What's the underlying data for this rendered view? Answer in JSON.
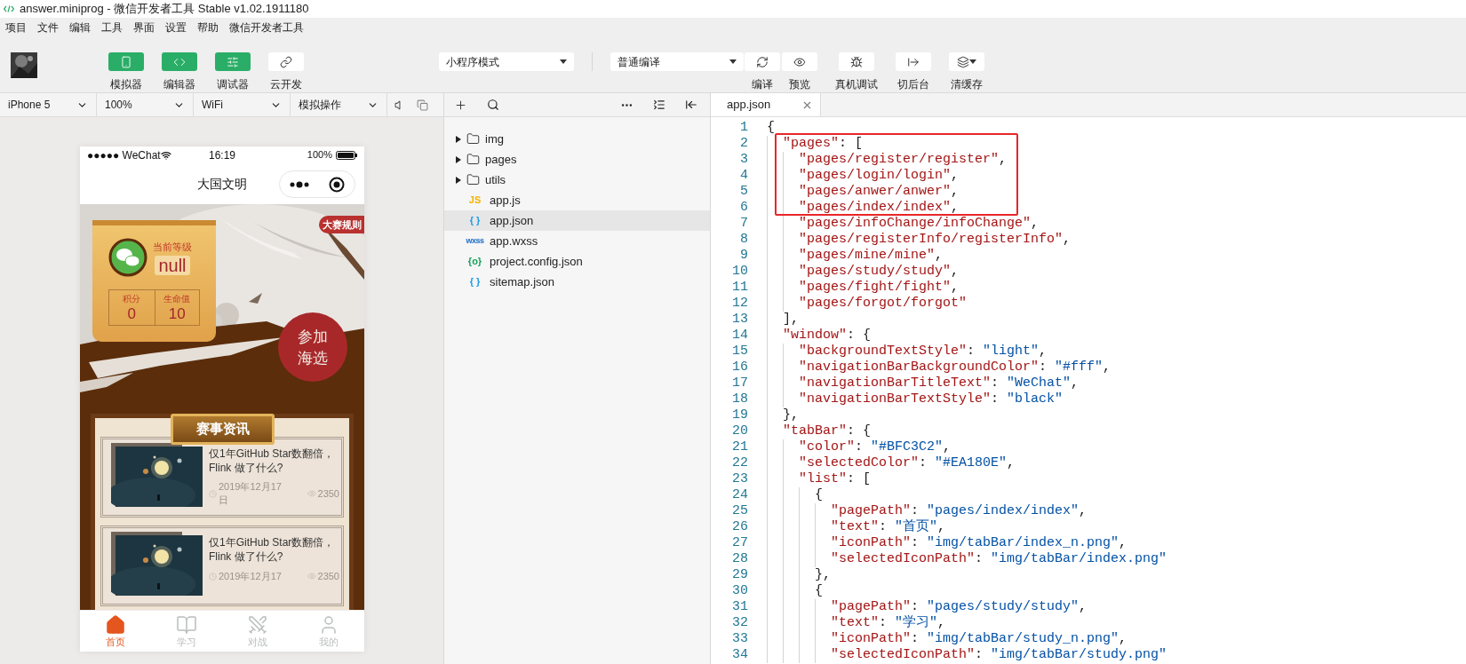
{
  "window": {
    "title": "answer.miniprog - 微信开发者工具 Stable v1.02.1911180"
  },
  "menu": [
    "项目",
    "文件",
    "编辑",
    "工具",
    "界面",
    "设置",
    "帮助",
    "微信开发者工具"
  ],
  "toolbar": {
    "left": [
      {
        "label": "模拟器",
        "kind": "phone",
        "on": true
      },
      {
        "label": "编辑器",
        "kind": "code",
        "on": true
      },
      {
        "label": "调试器",
        "kind": "debug",
        "on": true
      },
      {
        "label": "云开发",
        "kind": "cloud",
        "on": false
      }
    ],
    "mode": "小程序模式",
    "compile": "普通编译",
    "right": [
      {
        "label": "编译",
        "kind": "refresh"
      },
      {
        "label": "预览",
        "kind": "eye"
      },
      {
        "label": "真机调试",
        "kind": "bug"
      },
      {
        "label": "切后台",
        "kind": "switch"
      },
      {
        "label": "清缓存",
        "kind": "layers"
      }
    ]
  },
  "simulator_bar": [
    "iPhone 5",
    "100%",
    "WiFi",
    "模拟操作"
  ],
  "phone": {
    "status": {
      "carrier": "●●●●● WeChat",
      "time": "16:19",
      "battery": "100%"
    },
    "title": "大国文明",
    "profile": {
      "rank_label": "当前等级",
      "rank": "null",
      "stats": [
        {
          "label": "积分",
          "value": "0"
        },
        {
          "label": "生命值",
          "value": "10"
        }
      ]
    },
    "rules_badge": "大赛规则",
    "join_button": "参加海选",
    "section_title": "赛事资讯",
    "news": [
      {
        "title": "仅1年GitHub Star数翻倍，Flink 做了什么?",
        "date": "2019年12月17日",
        "views": "2350"
      },
      {
        "title": "仅1年GitHub Star数翻倍，Flink 做了什么?",
        "date": "2019年12月17",
        "views": "2350"
      }
    ],
    "tabbar": [
      {
        "label": "首页",
        "kind": "home",
        "selected": true
      },
      {
        "label": "学习",
        "kind": "book",
        "selected": false
      },
      {
        "label": "对战",
        "kind": "fight",
        "selected": false
      },
      {
        "label": "我的",
        "kind": "user",
        "selected": false
      }
    ]
  },
  "files": [
    {
      "name": "img",
      "kind": "folder",
      "expanded": false,
      "selected": false
    },
    {
      "name": "pages",
      "kind": "folder",
      "expanded": false,
      "selected": false
    },
    {
      "name": "utils",
      "kind": "folder",
      "expanded": false,
      "selected": false
    },
    {
      "name": "app.js",
      "kind": "file",
      "icon": "JS",
      "color": "#f5b400",
      "selected": false
    },
    {
      "name": "app.json",
      "kind": "file",
      "icon": "{ }",
      "color": "#1e9be6",
      "selected": true
    },
    {
      "name": "app.wxss",
      "kind": "file",
      "icon": "wxss",
      "color": "#1a6cc9",
      "selected": false
    },
    {
      "name": "project.config.json",
      "kind": "file",
      "icon": "{o}",
      "color": "#17a05a",
      "selected": false
    },
    {
      "name": "sitemap.json",
      "kind": "file",
      "icon": "{ }",
      "color": "#1e9be6",
      "selected": false
    }
  ],
  "editor": {
    "tabs": [
      {
        "label": "app.json",
        "selected": true
      }
    ],
    "lines": [
      {
        "no": "1",
        "text": "{",
        "marked": false
      },
      {
        "no": "2",
        "text": "  \"pages\": [",
        "marked": true
      },
      {
        "no": "3",
        "text": "    \"pages/register/register\",",
        "marked": true
      },
      {
        "no": "4",
        "text": "    \"pages/login/login\",",
        "marked": true
      },
      {
        "no": "5",
        "text": "    \"pages/anwer/anwer\",",
        "marked": true
      },
      {
        "no": "6",
        "text": "    \"pages/index/index\",",
        "marked": true
      },
      {
        "no": "7",
        "text": "    \"pages/infoChange/infoChange\",",
        "marked": false
      },
      {
        "no": "8",
        "text": "    \"pages/registerInfo/registerInfo\",",
        "marked": false
      },
      {
        "no": "9",
        "text": "    \"pages/mine/mine\",",
        "marked": false
      },
      {
        "no": "10",
        "text": "    \"pages/study/study\",",
        "marked": false
      },
      {
        "no": "11",
        "text": "    \"pages/fight/fight\",",
        "marked": false
      },
      {
        "no": "12",
        "text": "    \"pages/forgot/forgot\"",
        "marked": false
      },
      {
        "no": "13",
        "text": "  ],",
        "marked": false
      },
      {
        "no": "14",
        "text": "  \"window\": {",
        "marked": false
      },
      {
        "no": "15",
        "text": "    \"backgroundTextStyle\": \"light\",",
        "marked": false
      },
      {
        "no": "16",
        "text": "    \"navigationBarBackgroundColor\": \"#fff\",",
        "marked": false
      },
      {
        "no": "17",
        "text": "    \"navigationBarTitleText\": \"WeChat\",",
        "marked": false
      },
      {
        "no": "18",
        "text": "    \"navigationBarTextStyle\": \"black\"",
        "marked": false
      },
      {
        "no": "19",
        "text": "  },",
        "marked": false
      },
      {
        "no": "20",
        "text": "  \"tabBar\": {",
        "marked": false
      },
      {
        "no": "21",
        "text": "    \"color\": \"#BFC3C2\",",
        "marked": false
      },
      {
        "no": "22",
        "text": "    \"selectedColor\": \"#EA180E\",",
        "marked": false
      },
      {
        "no": "23",
        "text": "    \"list\": [",
        "marked": false
      },
      {
        "no": "24",
        "text": "      {",
        "marked": false
      },
      {
        "no": "25",
        "text": "        \"pagePath\": \"pages/index/index\",",
        "marked": false
      },
      {
        "no": "26",
        "text": "        \"text\": \"首页\",",
        "marked": false
      },
      {
        "no": "27",
        "text": "        \"iconPath\": \"img/tabBar/index_n.png\",",
        "marked": false
      },
      {
        "no": "28",
        "text": "        \"selectedIconPath\": \"img/tabBar/index.png\"",
        "marked": false
      },
      {
        "no": "29",
        "text": "      },",
        "marked": false
      },
      {
        "no": "30",
        "text": "      {",
        "marked": false
      },
      {
        "no": "31",
        "text": "        \"pagePath\": \"pages/study/study\",",
        "marked": false
      },
      {
        "no": "32",
        "text": "        \"text\": \"学习\",",
        "marked": false
      },
      {
        "no": "33",
        "text": "        \"iconPath\": \"img/tabBar/study_n.png\",",
        "marked": false
      },
      {
        "no": "34",
        "text": "        \"selectedIconPath\": \"img/tabBar/study.png\"",
        "marked": false
      }
    ]
  }
}
